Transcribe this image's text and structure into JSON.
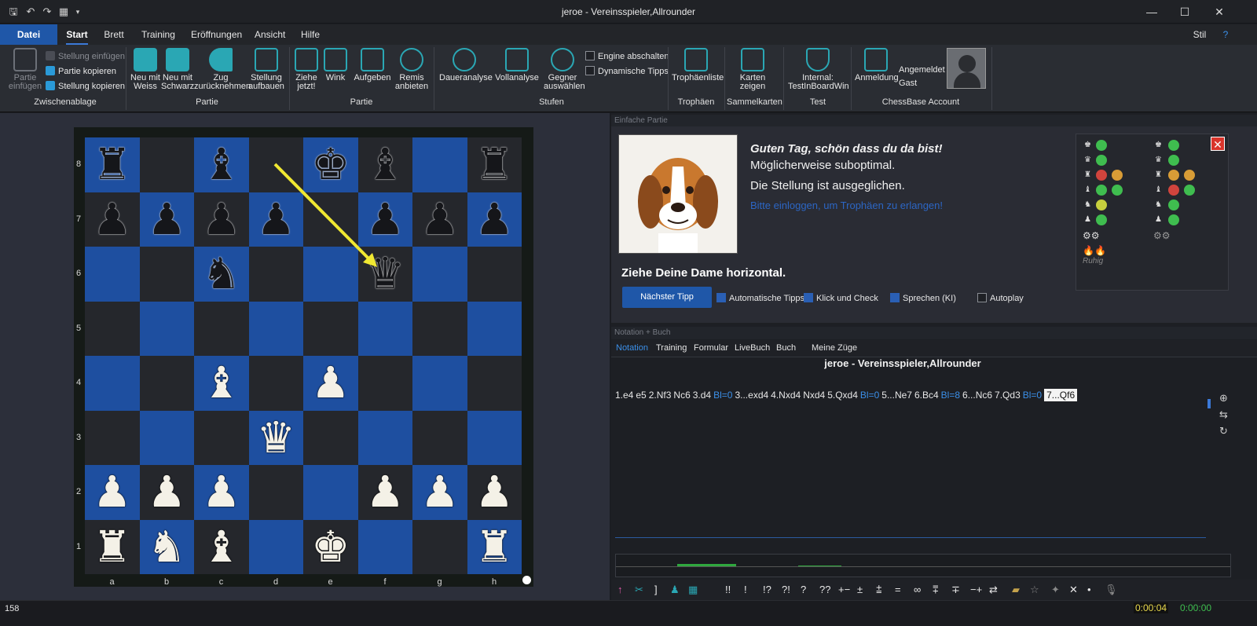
{
  "window": {
    "title": "jeroe - Vereinsspieler,Allrounder"
  },
  "menu": {
    "items": [
      "Datei",
      "Start",
      "Brett",
      "Training",
      "Eröffnungen",
      "Ansicht",
      "Hilfe"
    ],
    "stil": "Stil"
  },
  "ribbon": {
    "clipboard": {
      "paste_game": "Partie einfügen",
      "paste_position": "Stellung einfügen",
      "copy_game": "Partie kopieren",
      "copy_position": "Stellung kopieren",
      "group": "Zwischenablage"
    },
    "game": {
      "new_white": "Neu mit Weiss",
      "new_black": "Neu mit Schwarz",
      "takeback": "Zug zurücknehmen",
      "setup": "Stellung aufbauen",
      "group": "Partie"
    },
    "play": {
      "move_now": "Ziehe jetzt!",
      "hint": "Wink",
      "resign": "Aufgeben",
      "draw": "Remis anbieten",
      "group": "Partie"
    },
    "levels": {
      "continuous": "Daueranalyse",
      "full": "Vollanalyse",
      "opponent": "Gegner auswählen",
      "engine_off": "Engine abschalten",
      "dynamic_tips": "Dynamische Tipps",
      "group": "Stufen"
    },
    "trophies": {
      "list": "Trophäenliste",
      "group": "Trophäen"
    },
    "cards": {
      "show": "Karten zeigen",
      "group": "Sammelkarten"
    },
    "test": {
      "internal": "Internal: TestInBoardWin",
      "group": "Test"
    },
    "account": {
      "login": "Anmeldung",
      "logged_in": "Angemeldet",
      "guest": "Gast",
      "group": "ChessBase Account"
    }
  },
  "board": {
    "files": [
      "a",
      "b",
      "c",
      "d",
      "e",
      "f",
      "g",
      "h"
    ],
    "ranks": [
      "8",
      "7",
      "6",
      "5",
      "4",
      "3",
      "2",
      "1"
    ],
    "corner_dot": "●"
  },
  "coach": {
    "pane_title": "Einfache Partie",
    "greeting": "Guten Tag, schön dass du da bist!",
    "line2": "Möglicherweise suboptimal.",
    "line3": "Die Stellung ist ausgeglichen.",
    "login_link": "Bitte einloggen, um Trophäen zu erlangen!",
    "hint": "Ziehe Deine Dame horizontal.",
    "next_tip": "Nächster Tipp",
    "opt_auto": "Automatische Tipps",
    "opt_click": "Klick und Check",
    "opt_speak": "Sprechen (KI)",
    "opt_autoplay": "Autoplay",
    "mood": "Ruhig",
    "close": "✕"
  },
  "notation": {
    "pane_title": "Notation + Buch",
    "tabs": [
      "Notation",
      "Training",
      "Formular",
      "LiveBuch",
      "Buch",
      "Meine Züge"
    ],
    "game_title": "jeroe - Vereinsspieler,Allrounder",
    "moves": [
      {
        "t": "1.e4"
      },
      {
        "t": "e5"
      },
      {
        "t": "2.Nf3"
      },
      {
        "t": "Nc6"
      },
      {
        "t": "3.d4"
      },
      {
        "t": "Bl=0",
        "ev": true
      },
      {
        "t": "3...exd4"
      },
      {
        "t": "4.Nxd4"
      },
      {
        "t": "Nxd4"
      },
      {
        "t": "5.Qxd4"
      },
      {
        "t": "Bl=0",
        "ev": true
      },
      {
        "t": "5...Ne7"
      },
      {
        "t": "6.Bc4"
      },
      {
        "t": "Bl=8",
        "ev": true
      },
      {
        "t": "6...Nc6"
      },
      {
        "t": "7.Qd3"
      },
      {
        "t": "Bl=0",
        "ev": true
      },
      {
        "t": "7...Qf6",
        "cur": true
      }
    ]
  },
  "symbols": [
    "!!",
    "!",
    "!?",
    "?!",
    "?",
    "??",
    "+−",
    "±",
    "⩲",
    "=",
    "∞",
    "⩱",
    "∓",
    "−+",
    "⇄"
  ],
  "status": {
    "left": "158",
    "clock_white": "0:00:04",
    "clock_black": "0:00:00"
  }
}
